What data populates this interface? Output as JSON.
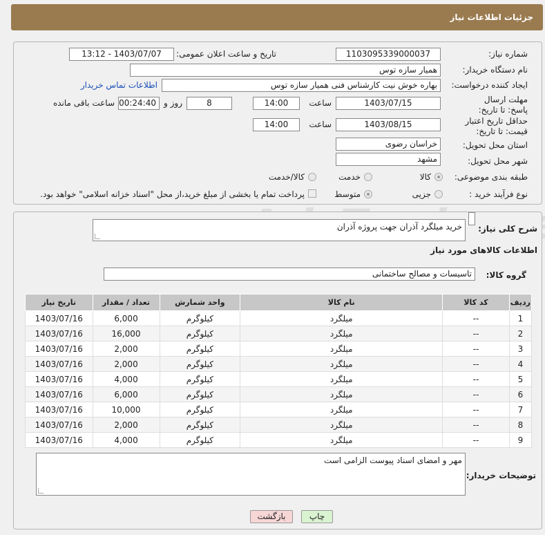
{
  "header": {
    "title": "جزئیات اطلاعات نیاز"
  },
  "form": {
    "need_number_label": "شماره نیاز:",
    "need_number": "1103095339000037",
    "announce_label": "تاریخ و ساعت اعلان عمومی:",
    "announce_value": "1403/07/07 - 13:12",
    "buyer_org_label": "نام دستگاه خریدار:",
    "buyer_org": "همیار سازه توس",
    "creator_label": "ایجاد کننده درخواست:",
    "creator": "بهاره خوش نیت کارشناس فنی همیار سازه توس",
    "contact_link": "اطلاعات تماس خریدار",
    "deadline_label": "مهلت ارسال پاسخ: تا تاریخ:",
    "deadline_date": "1403/07/15",
    "time_label": "ساعت",
    "deadline_time": "14:00",
    "days_value": "8",
    "days_label": "روز و",
    "remaining_time": "00:24:40",
    "remaining_label": "ساعت باقی مانده",
    "validity_label": "حداقل تاریخ اعتبار قیمت: تا تاریخ:",
    "validity_date": "1403/08/15",
    "validity_time": "14:00",
    "province_label": "استان محل تحویل:",
    "province": "خراسان رضوی",
    "city_label": "شهر محل تحویل:",
    "city": "مشهد",
    "category_label": "طبقه بندی موضوعی:",
    "cat_goods": "کالا",
    "cat_service": "خدمت",
    "cat_both": "کالا/خدمت",
    "process_label": "نوع فرآیند خرید :",
    "proc_partial": "جزیی",
    "proc_medium": "متوسط",
    "payment_note": "پرداخت تمام یا بخشی از مبلغ خرید،از محل \"اسناد خزانه اسلامی\" خواهد بود."
  },
  "details": {
    "summary_label": "شرح کلی نیاز:",
    "summary": "خرید میلگرد آذران جهت پروژه آذران",
    "goods_info_title": "اطلاعات کالاهای مورد نیاز",
    "goods_group_label": "گروه کالا:",
    "goods_group": "تاسیسات و مصالح ساختمانی",
    "table": {
      "headers": [
        "ردیف",
        "کد کالا",
        "نام کالا",
        "واحد شمارش",
        "تعداد / مقدار",
        "تاریخ نیاز"
      ],
      "rows": [
        [
          "1",
          "--",
          "میلگرد",
          "کیلوگرم",
          "6,000",
          "1403/07/16"
        ],
        [
          "2",
          "--",
          "میلگرد",
          "کیلوگرم",
          "16,000",
          "1403/07/16"
        ],
        [
          "3",
          "--",
          "میلگرد",
          "کیلوگرم",
          "2,000",
          "1403/07/16"
        ],
        [
          "4",
          "--",
          "میلگرد",
          "کیلوگرم",
          "2,000",
          "1403/07/16"
        ],
        [
          "5",
          "--",
          "میلگرد",
          "کیلوگرم",
          "4,000",
          "1403/07/16"
        ],
        [
          "6",
          "--",
          "میلگرد",
          "کیلوگرم",
          "6,000",
          "1403/07/16"
        ],
        [
          "7",
          "--",
          "میلگرد",
          "کیلوگرم",
          "10,000",
          "1403/07/16"
        ],
        [
          "8",
          "--",
          "میلگرد",
          "کیلوگرم",
          "2,000",
          "1403/07/16"
        ],
        [
          "9",
          "--",
          "میلگرد",
          "کیلوگرم",
          "4,000",
          "1403/07/16"
        ]
      ]
    },
    "buyer_notes_label": "توضیحات خریدار:",
    "buyer_notes": "مهر و امضای اسناد پیوست الزامی است"
  },
  "buttons": {
    "print": "چاپ",
    "back": "بازگشت"
  },
  "watermark": "AriaTender.net",
  "colors": {
    "header": "#9a7b4f",
    "link": "#1a4fb5",
    "back_button": "#f7d6d6",
    "print_button": "#d9f2d0"
  }
}
